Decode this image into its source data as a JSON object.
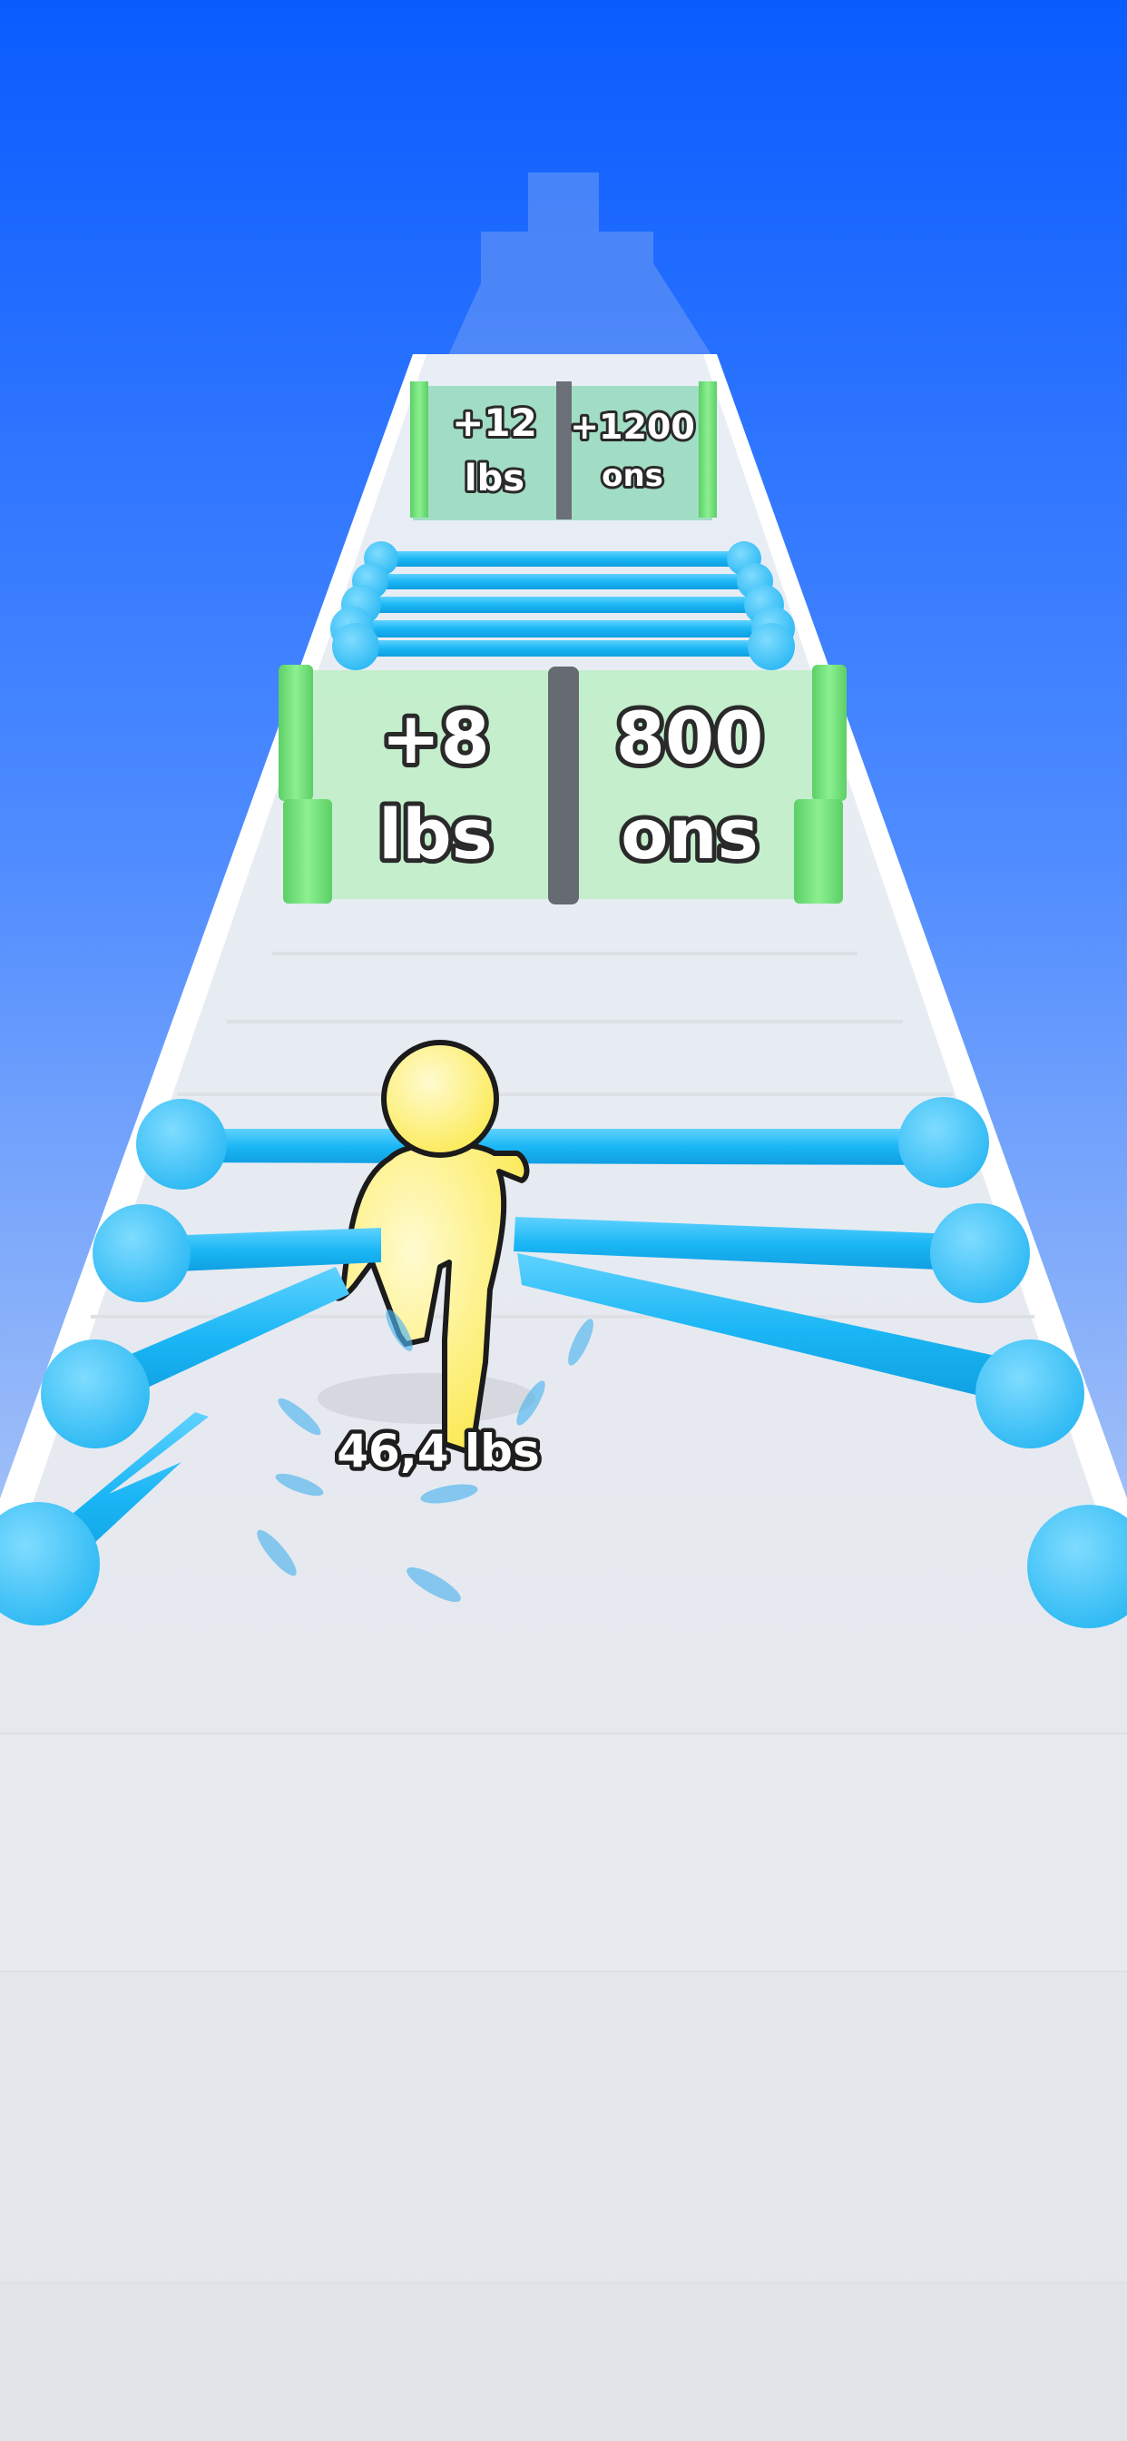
{
  "colors": {
    "sky_top": "#0a5cff",
    "sky_bottom": "#dfe7f2",
    "track": "#f1f3f6",
    "gate_panel": "#b9eec1",
    "gate_post": "#74e07c",
    "bar": "#1ab6f5",
    "bar_knob": "#45c6fb",
    "player": "#fff36b"
  },
  "gates": [
    {
      "left": {
        "line1": "+12",
        "line2": "lbs"
      },
      "right": {
        "line1": "+1200",
        "line2": "ons"
      }
    },
    {
      "left": {
        "line1": "+8",
        "line2": "lbs"
      },
      "right": {
        "line1": "800",
        "line2": "ons"
      }
    }
  ],
  "player": {
    "weight_label": "46,4 lbs"
  }
}
